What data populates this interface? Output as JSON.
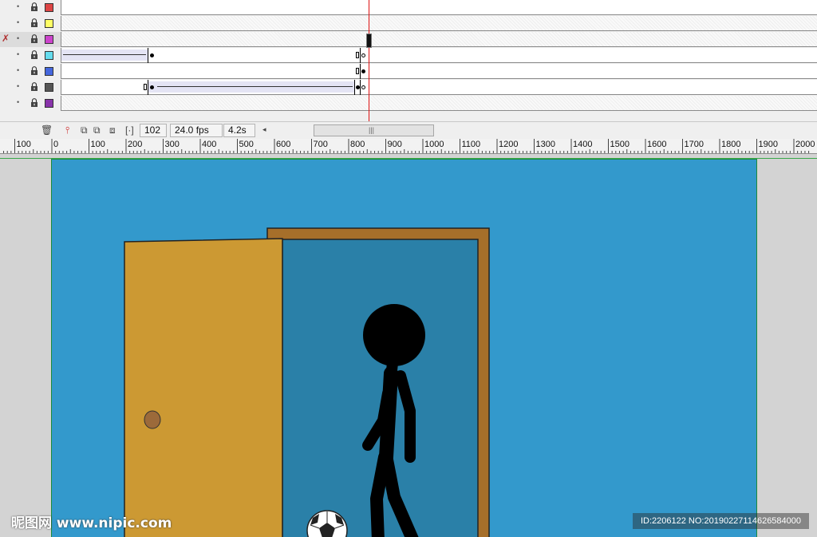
{
  "timeline": {
    "layers": [
      {
        "color": "#dd4444",
        "active": false,
        "locked": true
      },
      {
        "color": "#ffff66",
        "active": false,
        "locked": true
      },
      {
        "color": "#cc44cc",
        "active": true,
        "locked": true
      },
      {
        "color": "#66ddee",
        "active": false,
        "locked": true
      },
      {
        "color": "#4466dd",
        "active": false,
        "locked": true
      },
      {
        "color": "#555555",
        "active": false,
        "locked": true
      },
      {
        "color": "#8833aa",
        "active": false,
        "locked": true
      }
    ],
    "current_frame": "102",
    "frame_rate": "24.0 fps",
    "elapsed_time": "4.2s"
  },
  "ruler": {
    "labels": [
      "100",
      "0",
      "100",
      "200",
      "300",
      "400",
      "500",
      "600",
      "700",
      "800",
      "900",
      "1000",
      "1100",
      "1200",
      "1300",
      "1400",
      "1500",
      "1600",
      "1700",
      "1800",
      "1900",
      "2000"
    ]
  },
  "scene": {
    "background_color": "#3399cc",
    "door_color": "#cc9933",
    "door_frame_color": "#a66f2a",
    "doorway_color": "#2a80a8",
    "figure_color": "#000000",
    "knob_color": "#9c6a3a"
  },
  "watermark": {
    "logo_text": "昵图网 www.nipic.com",
    "id_text": "ID:2206122 NO:20190227114626584000"
  }
}
